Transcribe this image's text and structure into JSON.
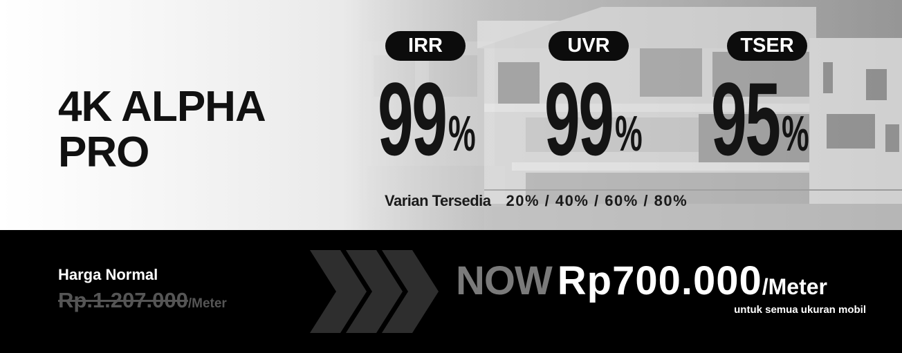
{
  "product": {
    "title_line1": "4K ALPHA",
    "title_line2": "PRO"
  },
  "metrics": [
    {
      "label": "IRR",
      "value": "99",
      "unit": "%"
    },
    {
      "label": "UVR",
      "value": "99",
      "unit": "%"
    },
    {
      "label": "TSER",
      "value": "95",
      "unit": "%"
    }
  ],
  "variants": {
    "label": "Varian Tersedia",
    "values": "20% / 40% / 60% / 80%"
  },
  "pricing": {
    "normal_label": "Harga Normal",
    "normal_amount": "Rp.1.207.000",
    "normal_unit": "/Meter",
    "now_label": "NOW",
    "now_amount": "Rp700.000",
    "now_unit": "/Meter",
    "note": "untuk semua ukuran mobil"
  },
  "colors": {
    "badge_bg": "#0c0c0c",
    "price_bar_bg": "#000000",
    "strikethrough_price": "#555555",
    "now_label": "#7a7a7a",
    "chevron": "#2e2e2e"
  },
  "icons": [
    "house-background-image",
    "chevron-arrows-icon"
  ]
}
